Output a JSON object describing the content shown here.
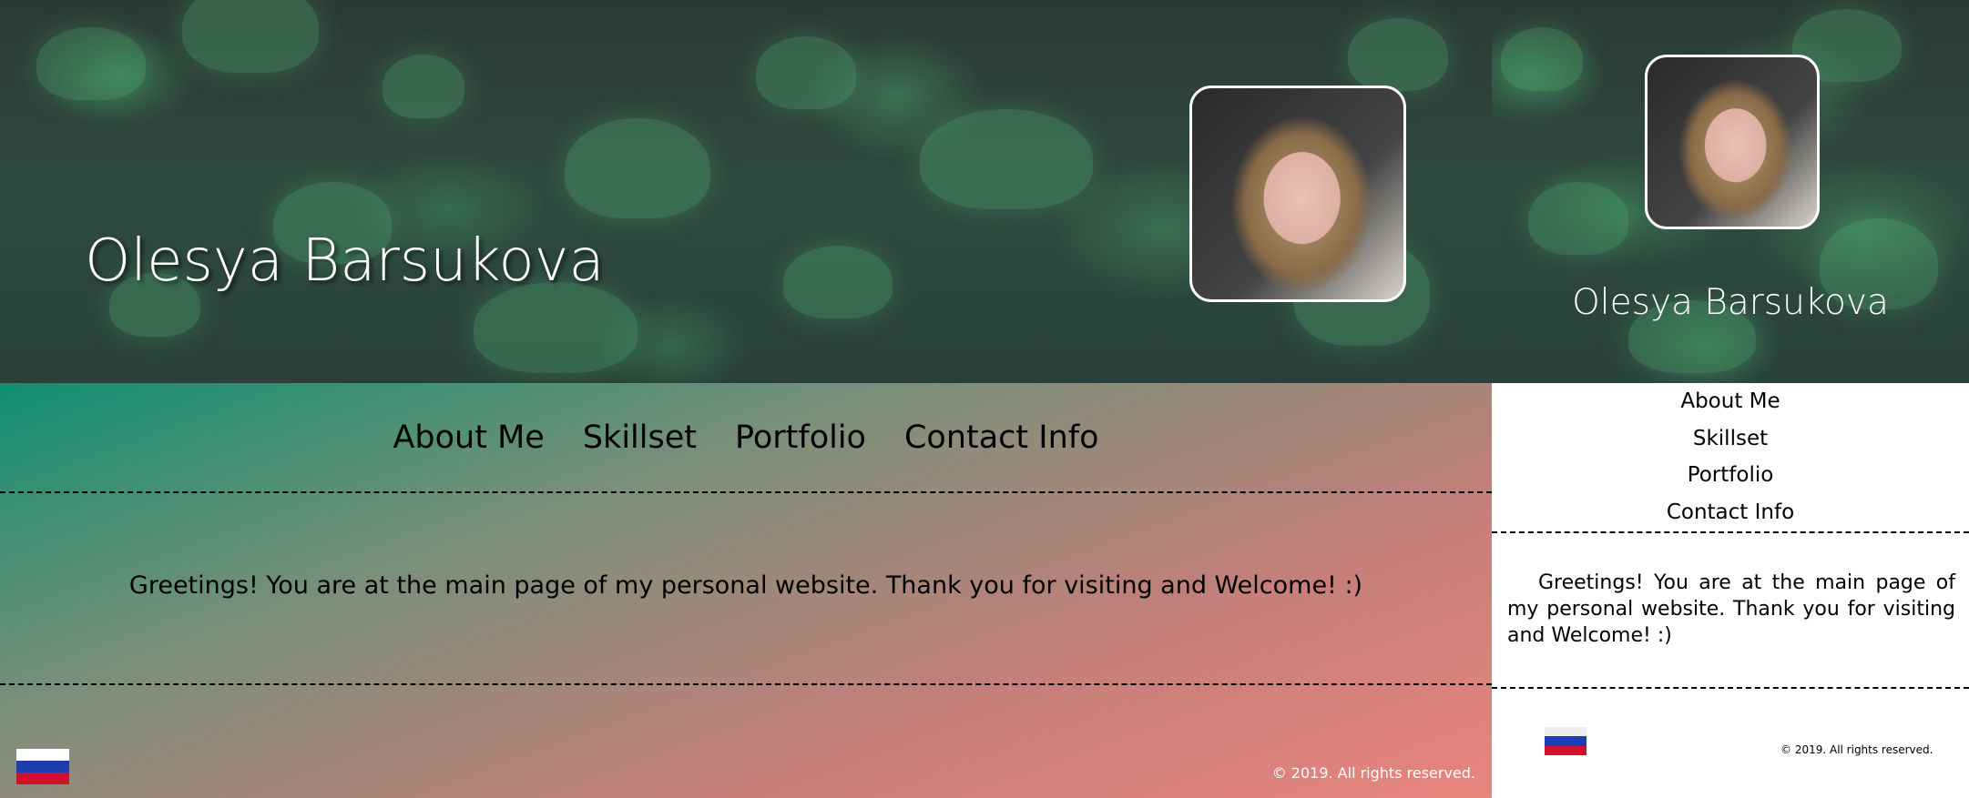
{
  "site_name": "Olesya Barsukova",
  "nav": [
    "About Me",
    "Skillset",
    "Portfolio",
    "Contact Info"
  ],
  "greeting": "Greetings! You are at the main page of my personal website. Thank you for visiting and Welcome! :)",
  "copyright": "© 2019. All rights reserved.",
  "language_flag": "russia-flag-icon",
  "colors": {
    "gradient_start": "#0f9070",
    "gradient_end": "#e9847e",
    "header_bg": "#2b3a35",
    "text": "#000000",
    "title_text": "#ffffff"
  }
}
